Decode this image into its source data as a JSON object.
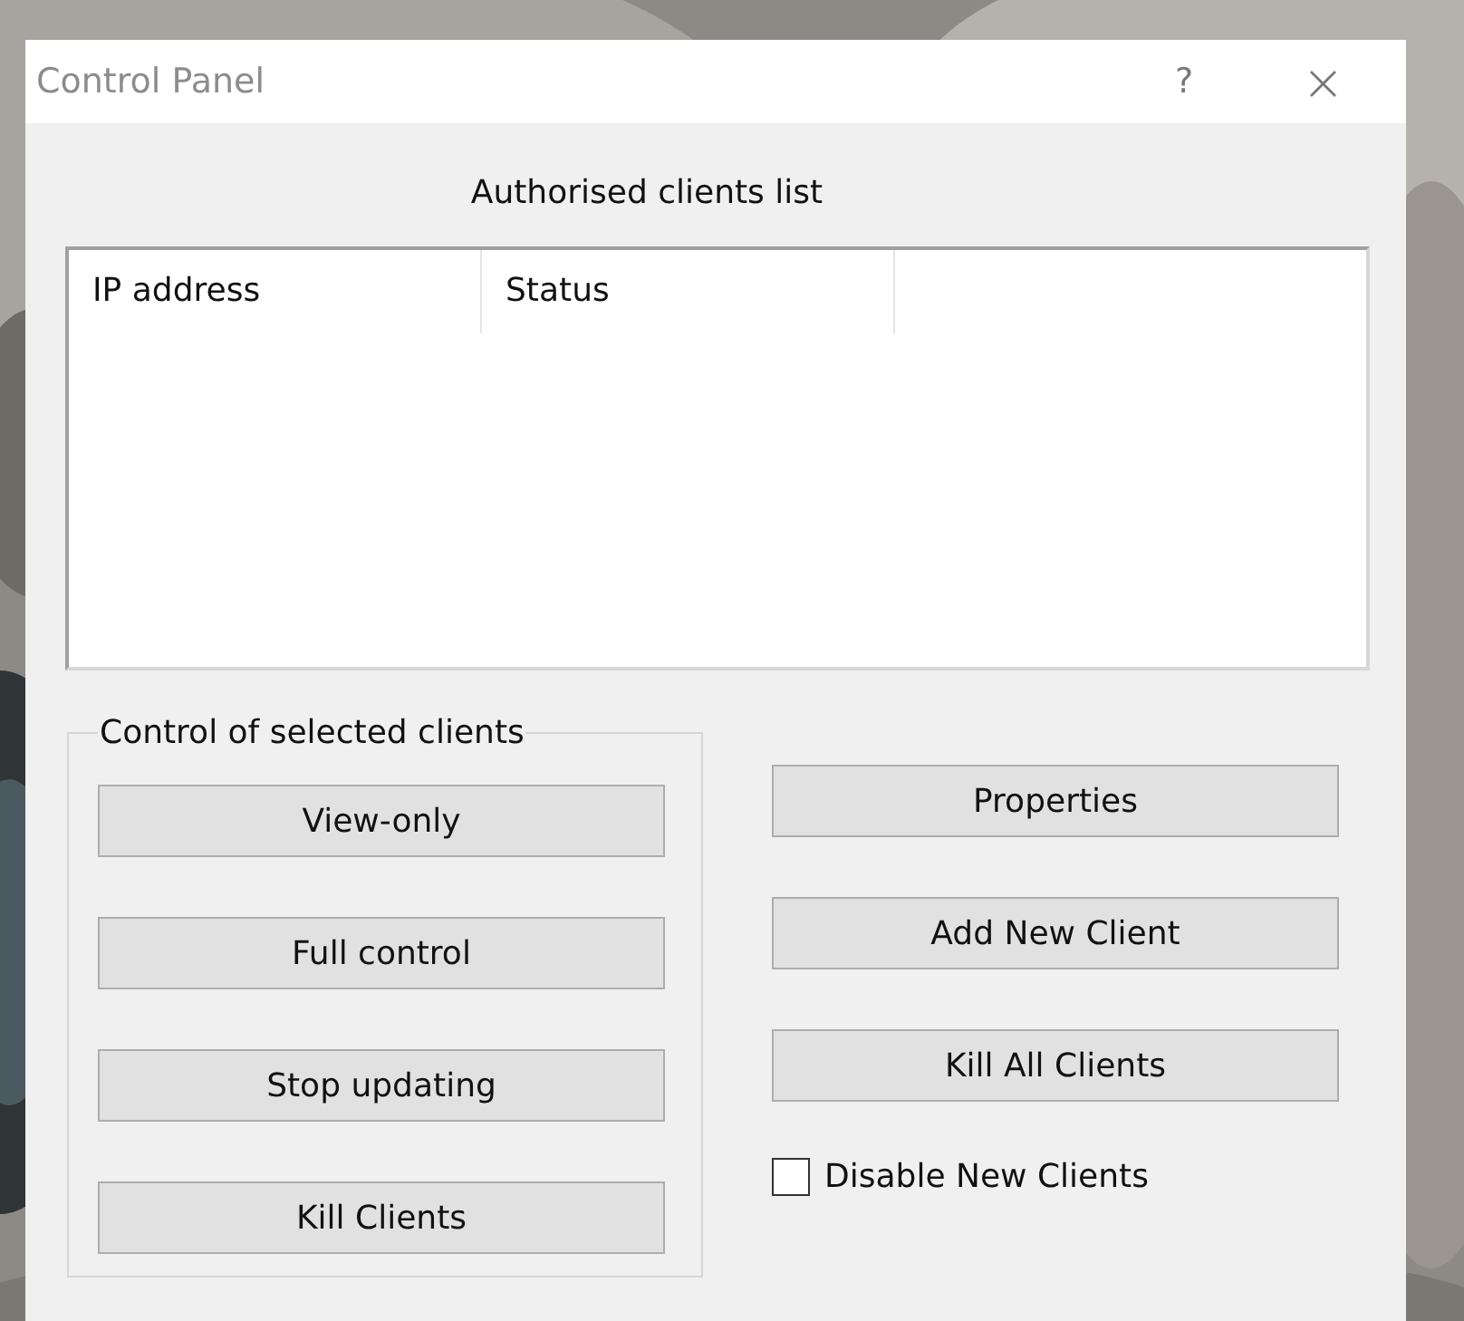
{
  "window": {
    "title": "Control Panel",
    "help_button": "?",
    "close_button": "×"
  },
  "clients_list": {
    "title": "Authorised clients list",
    "columns": [
      "IP address",
      "Status"
    ]
  },
  "group": {
    "title": "Control of selected clients",
    "buttons": [
      "View-only",
      "Full control",
      "Stop updating",
      "Kill Clients"
    ]
  },
  "right_buttons": [
    "Properties",
    "Add New Client",
    "Kill All Clients"
  ],
  "disable_new_clients": {
    "label": "Disable New Clients",
    "checked": false
  }
}
